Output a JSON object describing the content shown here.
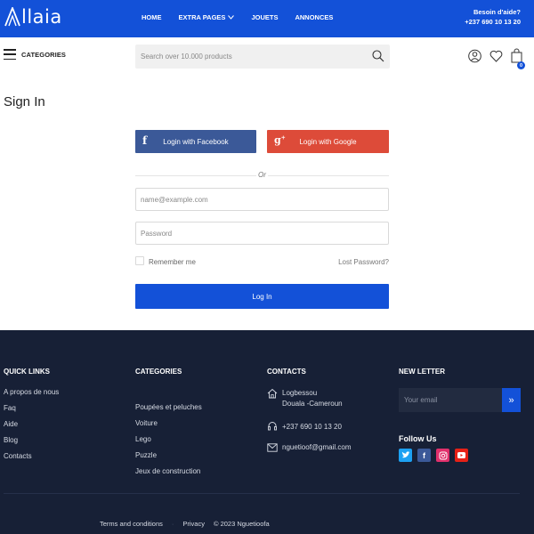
{
  "brand": {
    "logo_text": "llaia"
  },
  "nav": {
    "items": [
      "HOME",
      "EXTRA PAGES",
      "JOUETS",
      "ANNONCES"
    ]
  },
  "help": {
    "title": "Besoin d'aide?",
    "phone": "+237 690 10 13 20"
  },
  "header": {
    "categories_label": "CATEGORIES",
    "search_placeholder": "Search over 10.000 products",
    "cart_count": "0"
  },
  "page": {
    "title": "Sign In"
  },
  "login": {
    "facebook_label": "Login with Facebook",
    "google_label": "Login with Google",
    "or_label": "Or",
    "email_placeholder": "name@example.com",
    "password_placeholder": "Password",
    "remember_label": "Remember me",
    "lost_password_label": "Lost Password?",
    "submit_label": "Log In"
  },
  "footer": {
    "quick_links": {
      "title": "QUICK LINKS",
      "items": [
        "A propos de nous",
        "Faq",
        "Aide",
        "Blog",
        "Contacts"
      ]
    },
    "categories": {
      "title": "CATEGORIES",
      "items": [
        "Poupées et peluches",
        "Voiture",
        "Lego",
        "Puzzle",
        "Jeux de construction"
      ]
    },
    "contacts": {
      "title": "CONTACTS",
      "address_line1": "Logbessou",
      "address_line2": "Douala -Cameroun",
      "phone": "+237 690 10 13 20",
      "email": "nguetioof@gmail.com"
    },
    "newsletter": {
      "title": "NEW LETTER",
      "placeholder": "Your email",
      "follow_title": "Follow Us"
    },
    "bottom": {
      "terms": "Terms and conditions",
      "privacy": "Privacy",
      "copyright": "© 2023 Nguetioofa"
    }
  },
  "colors": {
    "primary": "#1351d8",
    "facebook": "#3b5998",
    "google": "#dd4b39",
    "footer_bg": "#172036",
    "twitter": "#1da1f2",
    "instagram": "#e1306c",
    "youtube": "#e62117"
  }
}
